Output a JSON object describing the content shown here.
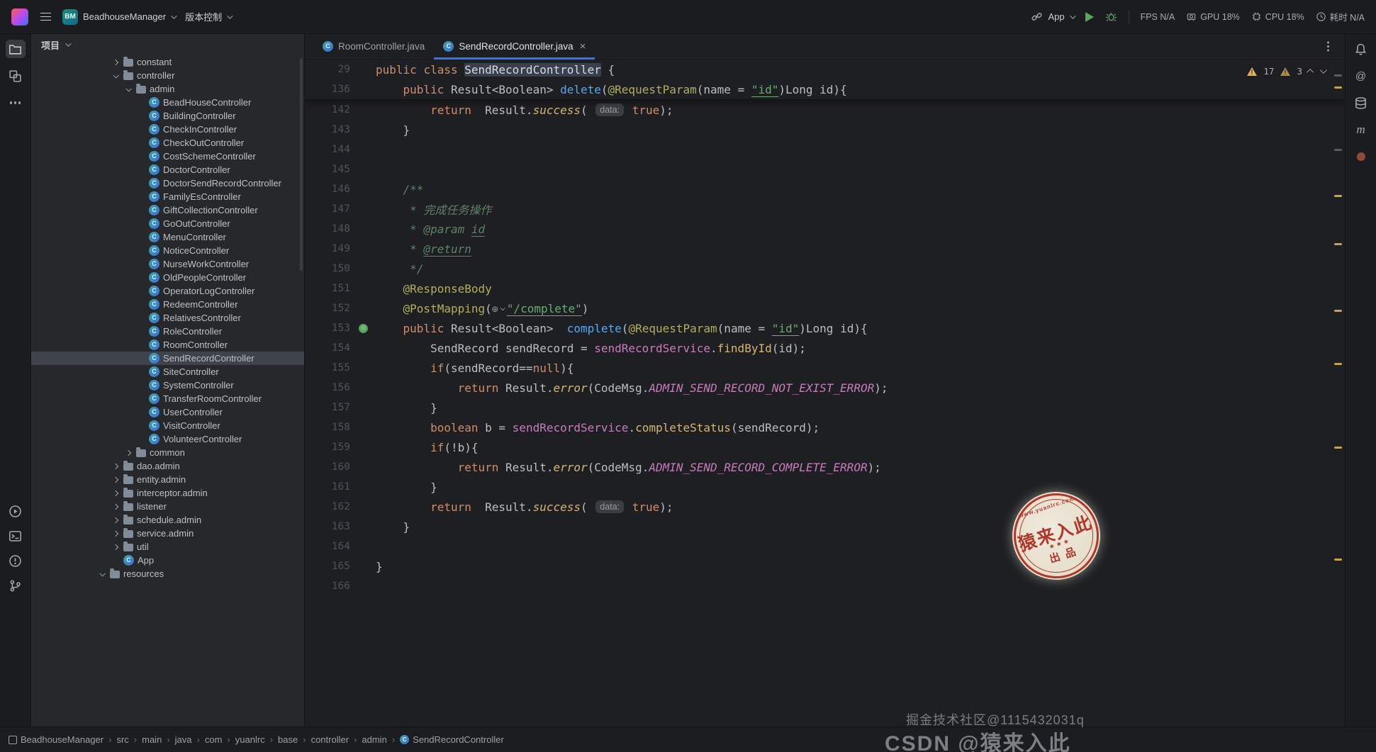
{
  "titlebar": {
    "project_badge": "BM",
    "project_name": "BeadhouseManager",
    "vcs": "版本控制",
    "run_config": "App",
    "perf": {
      "fps": "FPS N/A",
      "gpu": "GPU 18%",
      "cpu": "CPU 18%",
      "time": "耗时 N/A"
    }
  },
  "left_stripe": {
    "top": [
      "project-icon",
      "modules-icon",
      "more-icon"
    ],
    "bottom": [
      "run-icon",
      "terminal-icon",
      "problems-icon",
      "vcs-icon"
    ]
  },
  "right_stripe": {
    "top": [
      "notifications-icon",
      "at-icon",
      "database-icon",
      "maven-icon",
      "gradle-icon"
    ]
  },
  "project_panel": {
    "title": "项目",
    "items": [
      {
        "l": "constant",
        "ic": "folder",
        "ind": 112,
        "ch": "c"
      },
      {
        "l": "controller",
        "ic": "folder",
        "ind": 112,
        "ch": "o"
      },
      {
        "l": "admin",
        "ic": "folder",
        "ind": 130,
        "ch": "o"
      },
      {
        "l": "BeadHouseController",
        "ic": "class",
        "ind": 148
      },
      {
        "l": "BuildingController",
        "ic": "class",
        "ind": 148
      },
      {
        "l": "CheckInController",
        "ic": "class",
        "ind": 148
      },
      {
        "l": "CheckOutController",
        "ic": "class",
        "ind": 148
      },
      {
        "l": "CostSchemeController",
        "ic": "class",
        "ind": 148
      },
      {
        "l": "DoctorController",
        "ic": "class",
        "ind": 148
      },
      {
        "l": "DoctorSendRecordController",
        "ic": "class",
        "ind": 148
      },
      {
        "l": "FamilyEsController",
        "ic": "class",
        "ind": 148
      },
      {
        "l": "GiftCollectionController",
        "ic": "class",
        "ind": 148
      },
      {
        "l": "GoOutController",
        "ic": "class",
        "ind": 148
      },
      {
        "l": "MenuController",
        "ic": "class",
        "ind": 148
      },
      {
        "l": "NoticeController",
        "ic": "class",
        "ind": 148
      },
      {
        "l": "NurseWorkController",
        "ic": "class",
        "ind": 148
      },
      {
        "l": "OldPeopleController",
        "ic": "class",
        "ind": 148
      },
      {
        "l": "OperatorLogController",
        "ic": "class",
        "ind": 148
      },
      {
        "l": "RedeemController",
        "ic": "class",
        "ind": 148
      },
      {
        "l": "RelativesController",
        "ic": "class",
        "ind": 148
      },
      {
        "l": "RoleController",
        "ic": "class",
        "ind": 148
      },
      {
        "l": "RoomController",
        "ic": "class",
        "ind": 148
      },
      {
        "l": "SendRecordController",
        "ic": "class",
        "ind": 148,
        "sel": true
      },
      {
        "l": "SiteController",
        "ic": "class",
        "ind": 148
      },
      {
        "l": "SystemController",
        "ic": "class",
        "ind": 148
      },
      {
        "l": "TransferRoomController",
        "ic": "class",
        "ind": 148
      },
      {
        "l": "UserController",
        "ic": "class",
        "ind": 148
      },
      {
        "l": "VisitController",
        "ic": "class",
        "ind": 148
      },
      {
        "l": "VolunteerController",
        "ic": "class",
        "ind": 148
      },
      {
        "l": "common",
        "ic": "folder",
        "ind": 130,
        "ch": "c"
      },
      {
        "l": "dao.admin",
        "ic": "folder",
        "ind": 112,
        "ch": "c"
      },
      {
        "l": "entity.admin",
        "ic": "folder",
        "ind": 112,
        "ch": "c"
      },
      {
        "l": "interceptor.admin",
        "ic": "folder",
        "ind": 112,
        "ch": "c"
      },
      {
        "l": "listener",
        "ic": "folder",
        "ind": 112,
        "ch": "c"
      },
      {
        "l": "schedule.admin",
        "ic": "folder",
        "ind": 112,
        "ch": "c"
      },
      {
        "l": "service.admin",
        "ic": "folder",
        "ind": 112,
        "ch": "c"
      },
      {
        "l": "util",
        "ic": "folder",
        "ind": 112,
        "ch": "c"
      },
      {
        "l": "App",
        "ic": "class",
        "ind": 112
      },
      {
        "l": "resources",
        "ic": "folder",
        "ind": 93,
        "ch": "o"
      }
    ]
  },
  "tabs": [
    {
      "label": "RoomController.java",
      "icon": "class",
      "active": false
    },
    {
      "label": "SendRecordController.java",
      "icon": "class",
      "active": true,
      "closable": true
    }
  ],
  "editor": {
    "inspections": {
      "warnings": "17",
      "weak": "3"
    },
    "sticky_lines": [
      {
        "n": "29",
        "seg": [
          [
            "kw",
            "public "
          ],
          [
            "kw",
            "class "
          ],
          [
            "hlw",
            "SendRecordController"
          ],
          [
            "pl",
            " {"
          ]
        ]
      },
      {
        "n": "136",
        "seg": [
          [
            "pl",
            "    "
          ],
          [
            "kw",
            "public "
          ],
          [
            "pl",
            "Result<Boolean> "
          ],
          [
            "decl",
            "delete"
          ],
          [
            "pl",
            "("
          ],
          [
            "ann",
            "@RequestParam"
          ],
          [
            "pl",
            "(name = "
          ],
          [
            "strU",
            "\"id\""
          ],
          [
            "pl",
            ")Long id){"
          ]
        ]
      }
    ],
    "lines": [
      {
        "n": "142",
        "seg": [
          [
            "pl",
            "        "
          ],
          [
            "kw",
            "return"
          ],
          [
            "pl",
            "  Result."
          ],
          [
            "scall",
            "success"
          ],
          [
            "pl",
            "( "
          ],
          [
            "inlay",
            "data:"
          ],
          [
            "pl",
            " "
          ],
          [
            "kw",
            "true"
          ],
          [
            "pl",
            ");"
          ]
        ]
      },
      {
        "n": "143",
        "seg": [
          [
            "pl",
            "    }"
          ]
        ]
      },
      {
        "n": "144",
        "seg": []
      },
      {
        "n": "145",
        "seg": []
      },
      {
        "n": "146",
        "seg": [
          [
            "doc",
            "    /**"
          ]
        ]
      },
      {
        "n": "147",
        "seg": [
          [
            "doc",
            "     * 完成任务操作"
          ]
        ]
      },
      {
        "n": "148",
        "seg": [
          [
            "doc",
            "     * "
          ],
          [
            "doctag",
            "@param "
          ],
          [
            "docU",
            "id"
          ]
        ]
      },
      {
        "n": "149",
        "seg": [
          [
            "doc",
            "     * "
          ],
          [
            "docU",
            "@return"
          ]
        ]
      },
      {
        "n": "150",
        "seg": [
          [
            "doc",
            "     */"
          ]
        ]
      },
      {
        "n": "151",
        "seg": [
          [
            "pl",
            "    "
          ],
          [
            "ann",
            "@ResponseBody"
          ]
        ]
      },
      {
        "n": "152",
        "seg": [
          [
            "pl",
            "    "
          ],
          [
            "ann",
            "@PostMapping"
          ],
          [
            "pl",
            "("
          ],
          [
            "ginlay",
            ""
          ],
          [
            "strU",
            "\"/complete\""
          ],
          [
            "pl",
            ")"
          ]
        ]
      },
      {
        "n": "153",
        "g": "endpoint",
        "seg": [
          [
            "pl",
            "    "
          ],
          [
            "kw",
            "public "
          ],
          [
            "pl",
            "Result<Boolean>  "
          ],
          [
            "decl",
            "complete"
          ],
          [
            "pl",
            "("
          ],
          [
            "ann",
            "@RequestParam"
          ],
          [
            "pl",
            "(name = "
          ],
          [
            "strU",
            "\"id\""
          ],
          [
            "pl",
            ")Long id){"
          ]
        ]
      },
      {
        "n": "154",
        "seg": [
          [
            "pl",
            "        SendRecord sendRecord = "
          ],
          [
            "field",
            "sendRecordService"
          ],
          [
            "pl",
            "."
          ],
          [
            "call",
            "findById"
          ],
          [
            "pl",
            "(id);"
          ]
        ]
      },
      {
        "n": "155",
        "seg": [
          [
            "pl",
            "        "
          ],
          [
            "kw",
            "if"
          ],
          [
            "pl",
            "(sendRecord=="
          ],
          [
            "kw",
            "null"
          ],
          [
            "pl",
            "){"
          ]
        ]
      },
      {
        "n": "156",
        "seg": [
          [
            "pl",
            "            "
          ],
          [
            "kw",
            "return"
          ],
          [
            "pl",
            " Result."
          ],
          [
            "scall",
            "error"
          ],
          [
            "pl",
            "(CodeMsg."
          ],
          [
            "const",
            "ADMIN_SEND_RECORD_NOT_EXIST_ERROR"
          ],
          [
            "pl",
            ");"
          ]
        ]
      },
      {
        "n": "157",
        "seg": [
          [
            "pl",
            "        }"
          ]
        ]
      },
      {
        "n": "158",
        "seg": [
          [
            "pl",
            "        "
          ],
          [
            "kw",
            "boolean"
          ],
          [
            "pl",
            " b = "
          ],
          [
            "field",
            "sendRecordService"
          ],
          [
            "pl",
            "."
          ],
          [
            "call",
            "completeStatus"
          ],
          [
            "pl",
            "(sendRecord);"
          ]
        ]
      },
      {
        "n": "159",
        "seg": [
          [
            "pl",
            "        "
          ],
          [
            "kw",
            "if"
          ],
          [
            "pl",
            "(!b){"
          ]
        ]
      },
      {
        "n": "160",
        "seg": [
          [
            "pl",
            "            "
          ],
          [
            "kw",
            "return"
          ],
          [
            "pl",
            " Result."
          ],
          [
            "scall",
            "error"
          ],
          [
            "pl",
            "(CodeMsg."
          ],
          [
            "const",
            "ADMIN_SEND_RECORD_COMPLETE_ERROR"
          ],
          [
            "pl",
            ");"
          ]
        ]
      },
      {
        "n": "161",
        "seg": [
          [
            "pl",
            "        }"
          ]
        ]
      },
      {
        "n": "162",
        "seg": [
          [
            "pl",
            "        "
          ],
          [
            "kw",
            "return"
          ],
          [
            "pl",
            "  Result."
          ],
          [
            "scall",
            "success"
          ],
          [
            "pl",
            "( "
          ],
          [
            "inlay",
            "data:"
          ],
          [
            "pl",
            " "
          ],
          [
            "kw",
            "true"
          ],
          [
            "pl",
            ");"
          ]
        ]
      },
      {
        "n": "163",
        "seg": [
          [
            "pl",
            "    }"
          ]
        ]
      },
      {
        "n": "164",
        "seg": []
      },
      {
        "n": "165",
        "seg": [
          [
            "pl",
            "}"
          ]
        ]
      },
      {
        "n": "166",
        "seg": []
      }
    ],
    "stripe_marks": [
      {
        "t": 57,
        "c": "dim"
      },
      {
        "t": 74,
        "c": "warn"
      },
      {
        "t": 162,
        "c": "dim"
      },
      {
        "t": 227,
        "c": "warn"
      },
      {
        "t": 295,
        "c": "warn"
      },
      {
        "t": 389,
        "c": "warn"
      },
      {
        "t": 464,
        "c": "warn"
      },
      {
        "t": 582,
        "c": "warn"
      },
      {
        "t": 740,
        "c": "warn"
      }
    ]
  },
  "breadcrumbs": [
    {
      "t": "BeadhouseManager",
      "ic": "module"
    },
    {
      "t": "src"
    },
    {
      "t": "main"
    },
    {
      "t": "java"
    },
    {
      "t": "com"
    },
    {
      "t": "yuanlrc"
    },
    {
      "t": "base"
    },
    {
      "t": "controller"
    },
    {
      "t": "admin"
    },
    {
      "t": "SendRecordController",
      "ic": "class"
    }
  ],
  "watermark": {
    "stamp_site": "www.yuanlrc.com",
    "stamp_main": "猿来入此",
    "stamp_sub": "出品",
    "line1": "掘金技术社区@1115432031q",
    "line2": "CSDN @猿来入此"
  },
  "colors": {
    "accent": "#3574f0",
    "warning": "#c8a251",
    "stamp_red": "#b5372a",
    "selection": "#3e434c"
  }
}
